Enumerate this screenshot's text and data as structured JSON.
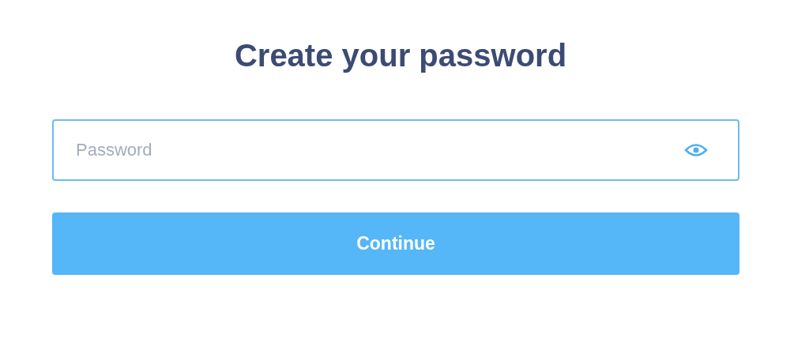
{
  "title": "Create your password",
  "password_field": {
    "placeholder": "Password"
  },
  "button": {
    "label": "Continue"
  }
}
